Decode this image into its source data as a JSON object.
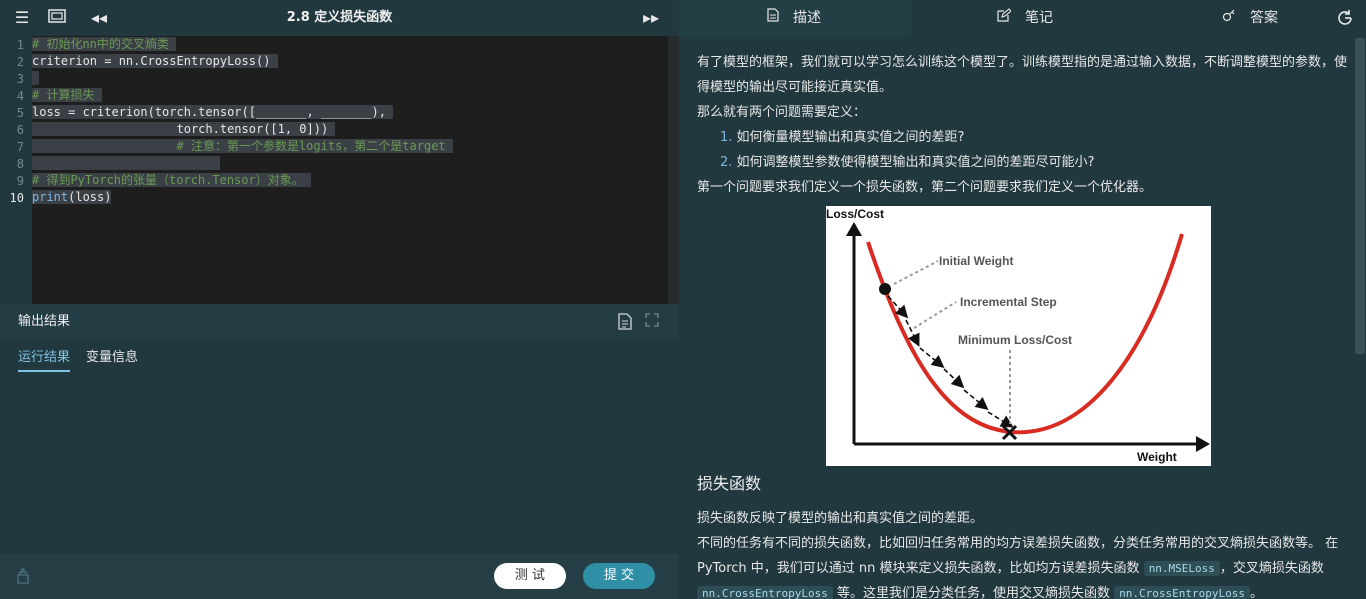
{
  "editor_top": {
    "title": "2.8 定义损失函数"
  },
  "code": {
    "line_numbers": [
      "1",
      "2",
      "3",
      "4",
      "5",
      "6",
      "7",
      "8",
      "9",
      "10"
    ],
    "line1": "# 初始化nn中的交叉熵类",
    "line2": "criterion = nn.CrossEntropyLoss()",
    "line4": "# 计算损失",
    "line5": "loss = criterion(torch.tensor([_______, _______),",
    "line6": "                    torch.tensor([1, 0]))",
    "line7": "                    # 注意：第一个参数是logits，第二个是target",
    "line9": "# 得到PyTorch的张量（torch.Tensor）对象。",
    "line10_fn": "print",
    "line10_rest": "(loss)"
  },
  "output": {
    "title": "输出结果",
    "tabs": [
      "运行结果",
      "变量信息"
    ]
  },
  "actions": {
    "test": "测 试",
    "submit": "提 交"
  },
  "right_tabs": [
    "描述",
    "笔记",
    "答案"
  ],
  "content": {
    "p1a": "有了模型的框架，我们就可以学习怎么训练这个模型了。训练模型指的是通过输入数据，不断调整模型的参数，使",
    "p1b": "得模型的输出尽可能接近真实值。",
    "p2": "那么就有两个问题需要定义：",
    "list": [
      {
        "num": "1.",
        "text": "如何衡量模型输出和真实值之间的差距?"
      },
      {
        "num": "2.",
        "text": "如何调整模型参数使得模型输出和真实值之间的差距尽可能小?"
      }
    ],
    "p3": "第一个问题要求我们定义一个损失函数，第二个问题要求我们定义一个优化器。",
    "figure": {
      "y_label": "Loss/Cost",
      "x_label": "Weight",
      "ann1": "Initial Weight",
      "ann2": "Incremental Step",
      "ann3": "Minimum Loss/Cost"
    },
    "h_loss": "损失函数",
    "p4": "损失函数反映了模型的输出和真实值之间的差距。",
    "p5": "不同的任务有不同的损失函数，比如回归任务常用的均方误差损失函数，分类任务常用的交叉熵损失函数等。 在",
    "p6a": "PyTorch 中，我们可以通过 nn 模块来定义损失函数，比如均方误差损失函数 ",
    "p6_code1": "nn.MSELoss",
    "p6b": "，交叉熵损失函数",
    "p7_code1": "nn.CrossEntropyLoss",
    "p7a": " 等。这里我们是分类任务，使用交叉熵损失函数 ",
    "p7_code2": "nn.CrossEntropyLoss",
    "p7b": "。"
  }
}
